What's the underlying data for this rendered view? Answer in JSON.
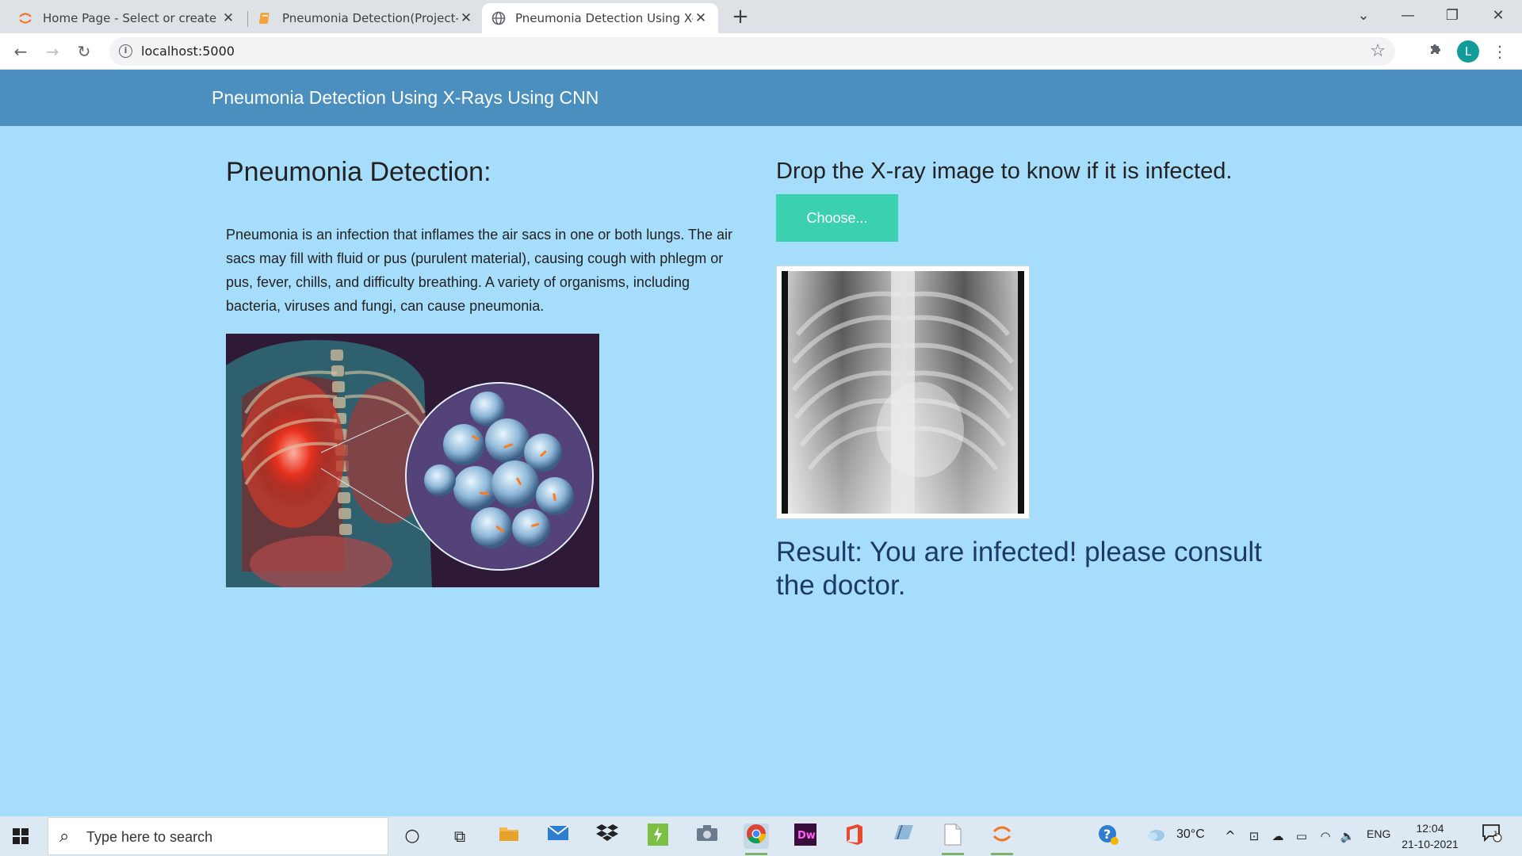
{
  "browser": {
    "tabs": [
      {
        "title": "Home Page - Select or create a n",
        "icon": "jupyter-icon"
      },
      {
        "title": "Pneumonia Detection(Project-Jup",
        "icon": "notebook-icon"
      },
      {
        "title": "Pneumonia Detection Using X-Ra",
        "icon": "globe-icon",
        "active": true
      }
    ],
    "url": "localhost:5000",
    "profile_initial": "L"
  },
  "page": {
    "navbar_title": "Pneumonia Detection Using X-Rays Using CNN",
    "heading": "Pneumonia Detection:",
    "description": "Pneumonia is an infection that inflames the air sacs in one or both lungs. The air sacs may fill with fluid or pus (purulent material), causing cough with phlegm or pus, fever, chills, and difficulty breathing. A variety of organisms, including bacteria, viruses and fungi, can cause pneumonia.",
    "upload_prompt": "Drop the X-ray image to know if it is infected.",
    "choose_button": "Choose...",
    "result": "Result: You are infected! please consult the doctor."
  },
  "taskbar": {
    "search_placeholder": "Type here to search",
    "temperature": "30°C",
    "language": "ENG",
    "time": "12:04",
    "date": "21-10-2021",
    "notification_count": "1"
  },
  "colors": {
    "page_bg": "#a6ddfb",
    "navbar_bg": "#4a8fbd",
    "button_bg": "#3bd1b0",
    "result_text": "#1d3a66"
  }
}
